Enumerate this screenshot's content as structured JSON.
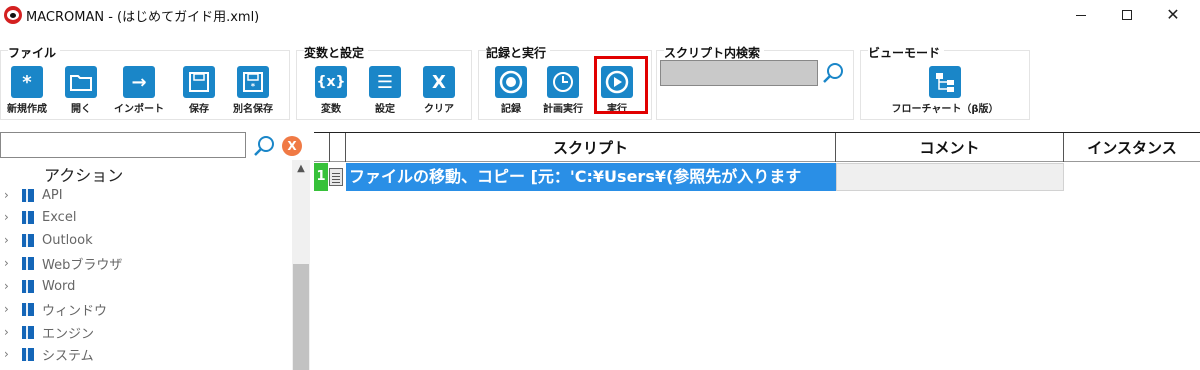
{
  "window": {
    "title": "MACROMAN - (はじめてガイド用.xml)",
    "controls": {
      "minimize": "",
      "maximize": "",
      "close": "✕"
    }
  },
  "ribbon": {
    "groups": [
      {
        "title": "ファイル",
        "buttons": [
          {
            "label": "新規作成",
            "icon": "new-icon",
            "glyph": "*"
          },
          {
            "label": "開く",
            "icon": "folder-icon",
            "glyph": ""
          },
          {
            "label": "インポート",
            "icon": "import-icon",
            "glyph": "→"
          },
          {
            "label": "保存",
            "icon": "save-icon",
            "glyph": ""
          },
          {
            "label": "別名保存",
            "icon": "save-as-icon",
            "glyph": ""
          }
        ]
      },
      {
        "title": "変数と設定",
        "buttons": [
          {
            "label": "変数",
            "icon": "variable-icon",
            "glyph": "{x}"
          },
          {
            "label": "設定",
            "icon": "settings-icon",
            "glyph": "☰"
          },
          {
            "label": "クリア",
            "icon": "clear-icon",
            "glyph": "X"
          }
        ]
      },
      {
        "title": "記録と実行",
        "buttons": [
          {
            "label": "記録",
            "icon": "record-icon",
            "glyph": ""
          },
          {
            "label": "計画実行",
            "icon": "schedule-icon",
            "glyph": ""
          },
          {
            "label": "実行",
            "icon": "play-icon",
            "glyph": ""
          }
        ]
      },
      {
        "title": "スクリプト内検索",
        "search_value": ""
      },
      {
        "title": "ビューモード",
        "buttons": [
          {
            "label": "フローチャート（β版）",
            "icon": "flowchart-icon",
            "glyph": ""
          }
        ]
      }
    ]
  },
  "left_panel": {
    "search_value": "",
    "clear_label": "X",
    "tree_root": "アクション",
    "items": [
      "API",
      "Excel",
      "Outlook",
      "Webブラウザ",
      "Word",
      "ウィンドウ",
      "エンジン",
      "システム"
    ]
  },
  "grid": {
    "columns": [
      "スクリプト",
      "コメント",
      "インスタンス"
    ],
    "rows": [
      {
        "number": "1",
        "script": "ファイルの移動、コピー [元：'C:¥Users¥(参照先が入ります",
        "comment": ""
      }
    ]
  },
  "colors": {
    "accent": "#1a86c8",
    "selection": "#2a8fe6",
    "row_number": "#37c13a",
    "highlight": "#e10000"
  }
}
